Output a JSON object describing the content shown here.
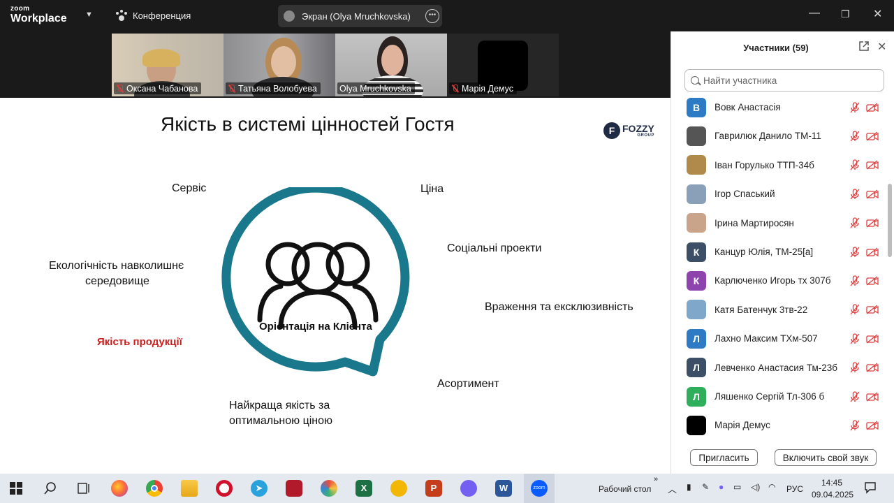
{
  "app": {
    "brand_top": "zoom",
    "brand_bottom": "Workplace",
    "meeting_label": "Конференция"
  },
  "screen_share": {
    "label": "Экран (Olya Mruchkovska)"
  },
  "window_controls": {
    "minimize": "—",
    "restore": "❐",
    "close": "✕"
  },
  "video_tiles": [
    {
      "name": "Оксана Чабанова",
      "muted": true,
      "active": false
    },
    {
      "name": "Татьяна Волобуева",
      "muted": true,
      "active": false
    },
    {
      "name": "Olya Mruchkovska",
      "muted": false,
      "active": true
    },
    {
      "name": "Марія Демус",
      "muted": true,
      "active": false
    }
  ],
  "slide": {
    "title": "Якість в системі цінностей Гостя",
    "logo_text": "FOZZY",
    "logo_sub": "GROUP",
    "center_label": "Орієнтація на Клієнта",
    "items": {
      "service": "Сервіс",
      "price": "Ціна",
      "social": "Соціальні проекти",
      "eco_1": "Екологічність навколишнє",
      "eco_2": "середовище",
      "impressions": "Враження  та ексклюзивність",
      "product_quality": "Якість продукції",
      "assortment": "Асортимент",
      "best_1": "Найкраща якість за",
      "best_2": "оптимальною ціною"
    },
    "accent_color": "#19788b",
    "highlight_color": "#c81e1e"
  },
  "participants": {
    "title": "Участники (59)",
    "search_placeholder": "Найти участника",
    "list": [
      {
        "name": "Вовк Анастасія",
        "initial": "В",
        "color": "#2d7bc4"
      },
      {
        "name": "Гаврилюк Данило ТМ-11",
        "initial": "",
        "color": "#555555"
      },
      {
        "name": "Іван Горулько ТТП-34б",
        "initial": "",
        "color": "#b08a4a"
      },
      {
        "name": "Ігор Спаський",
        "initial": "",
        "color": "#8aa0b8"
      },
      {
        "name": "Ірина Мартиросян",
        "initial": "",
        "color": "#c9a48a"
      },
      {
        "name": "Канцур Юлія, ТМ-25[а]",
        "initial": "К",
        "color": "#3d4f66"
      },
      {
        "name": "Карлюченко Игорь тх 307б",
        "initial": "К",
        "color": "#8e44ad"
      },
      {
        "name": "Катя Батенчук 3тв-22",
        "initial": "",
        "color": "#7fa7c9"
      },
      {
        "name": "Лахно Максим ТХм-507",
        "initial": "Л",
        "color": "#2d7bc4"
      },
      {
        "name": "Левченко Анастасия Тм-23б",
        "initial": "Л",
        "color": "#3d4f66"
      },
      {
        "name": "Ляшенко Сергій Тл-306 б",
        "initial": "Л",
        "color": "#2fae5b"
      },
      {
        "name": "Марія Демус",
        "initial": "",
        "color": "#000000"
      }
    ],
    "invite_label": "Пригласить",
    "unmute_label": "Включить свой звук"
  },
  "taskbar": {
    "desktop_label": "Рабочий стол",
    "lang": "РУС",
    "time": "14:45",
    "date": "09.04.2025",
    "desktop_chevron": "»"
  }
}
